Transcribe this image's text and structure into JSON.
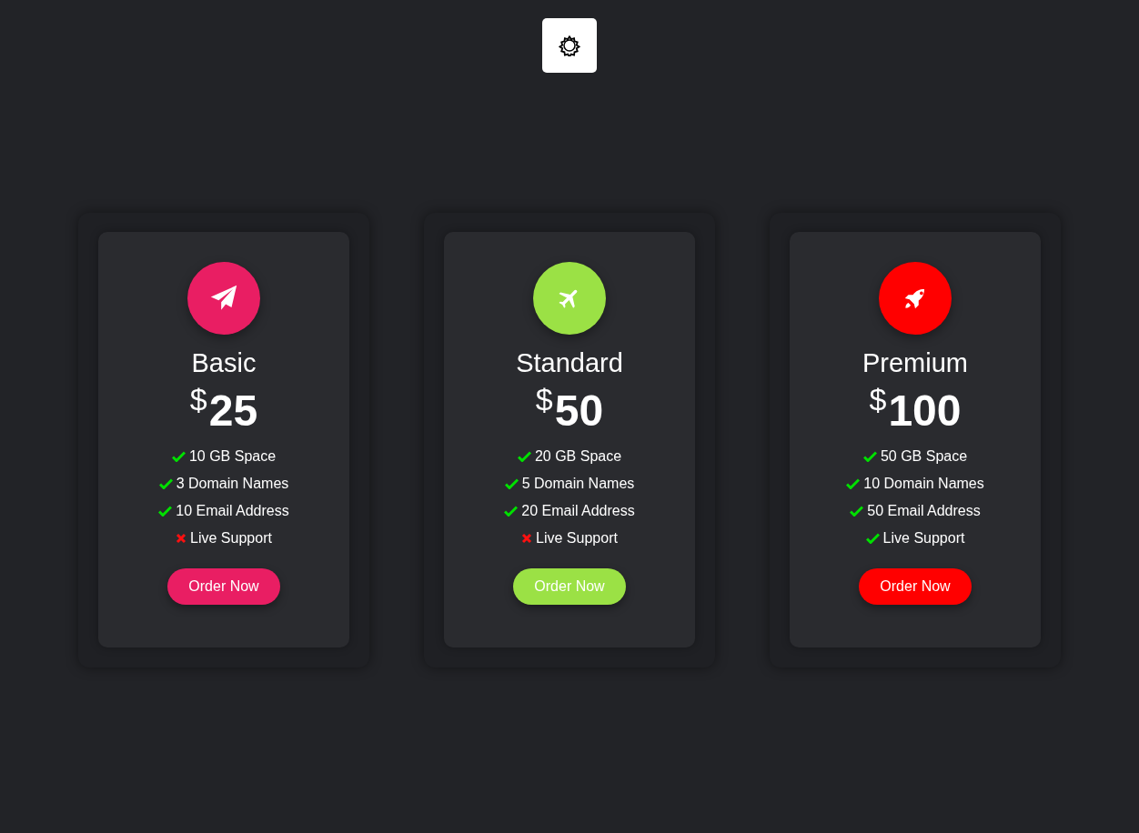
{
  "plans": [
    {
      "name": "Basic",
      "currency": "$",
      "amount": "25",
      "color": "#e91e63",
      "button": "Order Now",
      "features": [
        {
          "text": "10 GB Space",
          "included": true
        },
        {
          "text": "3 Domain Names",
          "included": true
        },
        {
          "text": "10 Email Address",
          "included": true
        },
        {
          "text": "Live Support",
          "included": false
        }
      ]
    },
    {
      "name": "Standard",
      "currency": "$",
      "amount": "50",
      "color": "#9be145",
      "button": "Order Now",
      "features": [
        {
          "text": "20 GB Space",
          "included": true
        },
        {
          "text": "5 Domain Names",
          "included": true
        },
        {
          "text": "20 Email Address",
          "included": true
        },
        {
          "text": "Live Support",
          "included": false
        }
      ]
    },
    {
      "name": "Premium",
      "currency": "$",
      "amount": "100",
      "color": "#ff0000",
      "button": "Order Now",
      "features": [
        {
          "text": "50 GB Space",
          "included": true
        },
        {
          "text": "10 Domain Names",
          "included": true
        },
        {
          "text": "50 Email Address",
          "included": true
        },
        {
          "text": "Live Support",
          "included": true
        }
      ]
    }
  ]
}
